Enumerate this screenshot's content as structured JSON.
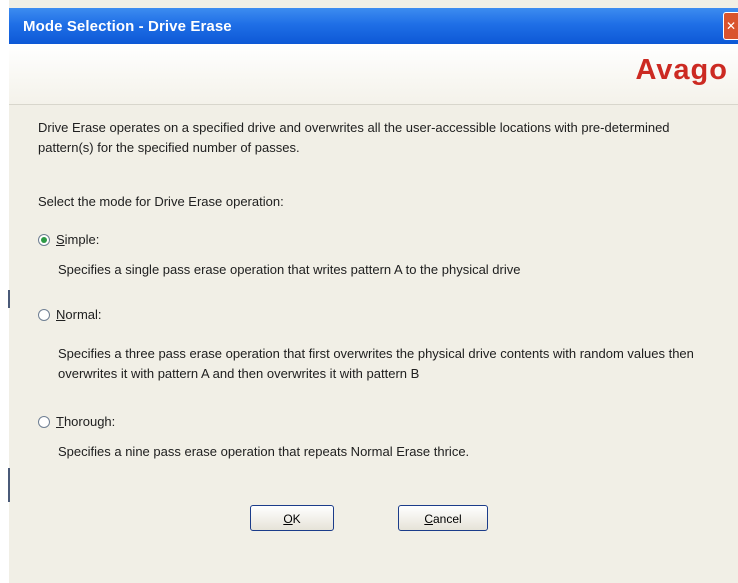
{
  "window": {
    "title": "Mode Selection - Drive Erase",
    "close_glyph": "✕"
  },
  "banner": {
    "logo": "Avago"
  },
  "intro": "Drive Erase operates on a specified drive and overwrites all the user-accessible locations with pre-determined pattern(s) for the specified number of passes.",
  "prompt": "Select the mode for Drive Erase operation:",
  "options": [
    {
      "mnemonic": "S",
      "rest": "imple:",
      "checked": true,
      "description": "Specifies a single pass erase operation that writes pattern A to the physical drive"
    },
    {
      "mnemonic": "N",
      "rest": "ormal:",
      "checked": false,
      "description": "Specifies a three pass erase operation that first overwrites the physical drive contents with random values then overwrites it with pattern A and then overwrites it with pattern B"
    },
    {
      "mnemonic": "T",
      "rest": "horough:",
      "checked": false,
      "description": "Specifies a nine pass erase operation that repeats Normal Erase thrice."
    }
  ],
  "buttons": {
    "ok": {
      "mnemonic": "O",
      "rest": "K"
    },
    "cancel": {
      "mnemonic": "C",
      "rest": "ancel"
    }
  }
}
